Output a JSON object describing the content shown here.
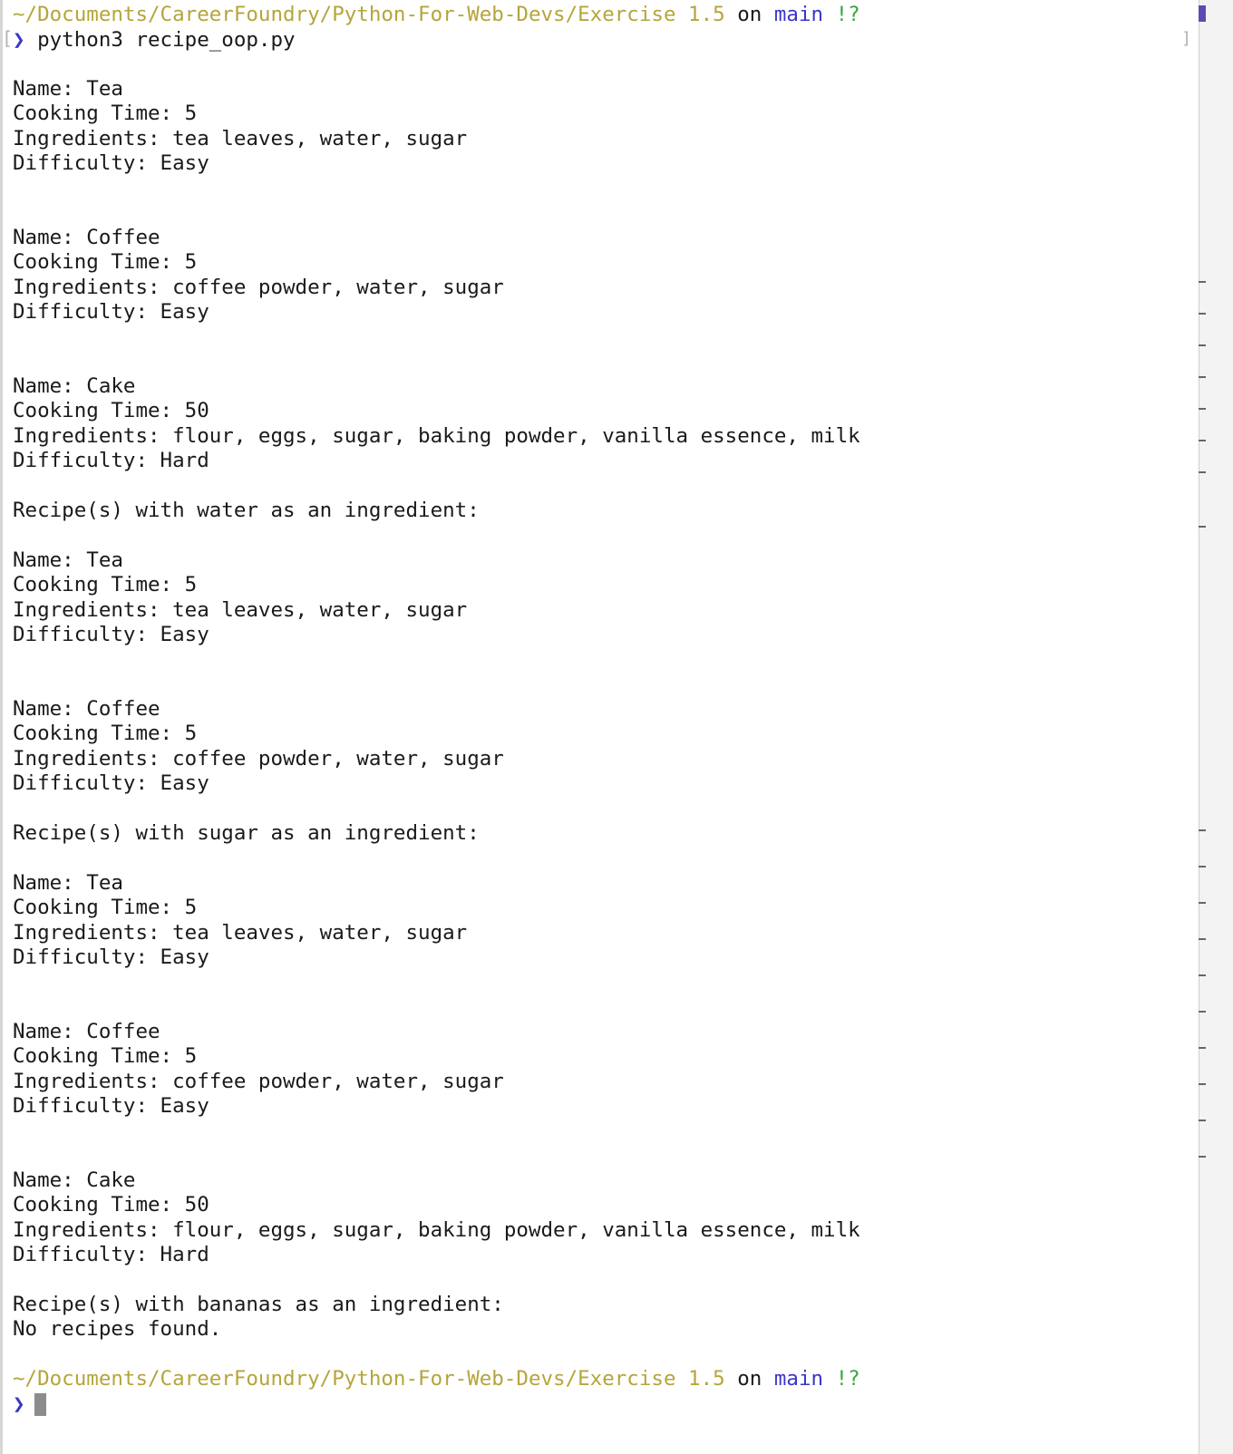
{
  "prompt": {
    "path": "~/Documents/CareerFoundry/Python-For-Web-Devs/Exercise 1.5",
    "on": "on",
    "branch": "main",
    "status": "!?",
    "symbol": "❯"
  },
  "command": "python3 recipe_oop.py",
  "output": {
    "l1": "Name: Tea",
    "l2": "Cooking Time: 5",
    "l3": "Ingredients: tea leaves, water, sugar",
    "l4": "Difficulty: Easy",
    "l5": "Name: Coffee",
    "l6": "Cooking Time: 5",
    "l7": "Ingredients: coffee powder, water, sugar",
    "l8": "Difficulty: Easy",
    "l9": "Name: Cake",
    "l10": "Cooking Time: 50",
    "l11": "Ingredients: flour, eggs, sugar, baking powder, vanilla essence, milk",
    "l12": "Difficulty: Hard",
    "l13": "Recipe(s) with water as an ingredient:",
    "l14": "Name: Tea",
    "l15": "Cooking Time: 5",
    "l16": "Ingredients: tea leaves, water, sugar",
    "l17": "Difficulty: Easy",
    "l18": "Name: Coffee",
    "l19": "Cooking Time: 5",
    "l20": "Ingredients: coffee powder, water, sugar",
    "l21": "Difficulty: Easy",
    "l22": "Recipe(s) with sugar as an ingredient:",
    "l23": "Name: Tea",
    "l24": "Cooking Time: 5",
    "l25": "Ingredients: tea leaves, water, sugar",
    "l26": "Difficulty: Easy",
    "l27": "Name: Coffee",
    "l28": "Cooking Time: 5",
    "l29": "Ingredients: coffee powder, water, sugar",
    "l30": "Difficulty: Easy",
    "l31": "Name: Cake",
    "l32": "Cooking Time: 50",
    "l33": "Ingredients: flour, eggs, sugar, baking powder, vanilla essence, milk",
    "l34": "Difficulty: Hard",
    "l35": "Recipe(s) with bananas as an ingredient:",
    "l36": "No recipes found."
  },
  "colors": {
    "path": "#b5a53a",
    "branch": "#3a36c8",
    "status": "#3aa53a",
    "text": "#1a1a1a"
  }
}
